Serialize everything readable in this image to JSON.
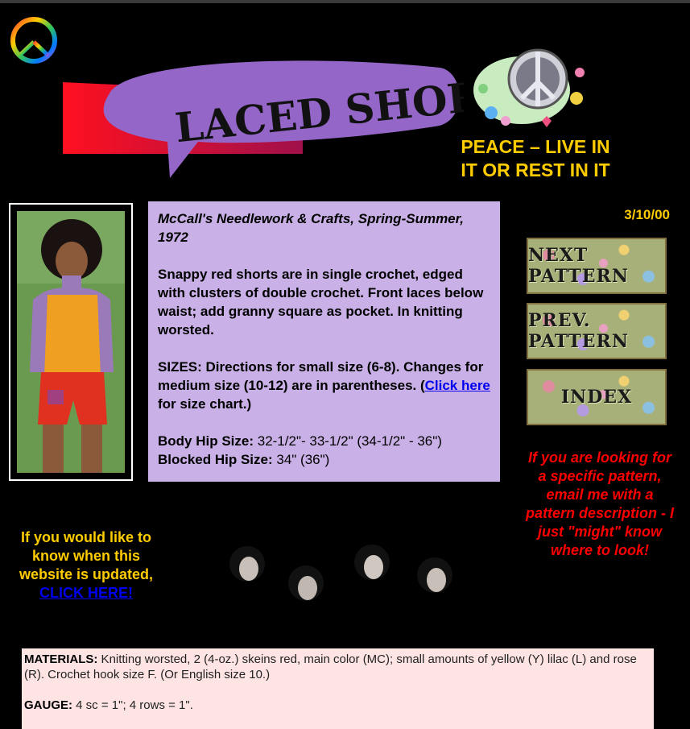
{
  "banner": {
    "title": "LACED SHORTS"
  },
  "motto": {
    "line1": "PEACE – LIVE IN",
    "line2": "IT OR REST IN IT"
  },
  "date": "3/10/00",
  "description": {
    "source": "McCall's Needlework & Crafts, Spring-Summer, 1972",
    "body": "Snappy red shorts are in single crochet, edged with clusters of double crochet. Front laces below waist; add granny square as pocket. In knitting worsted.",
    "sizes_label": "SIZES:",
    "sizes_text_1": " Directions for small size (6-8). Changes for medium size (10-12) are in parentheses. (",
    "size_chart_link": "Click here",
    "sizes_text_2": " for size chart.)",
    "body_hip_label": "Body Hip Size:",
    "body_hip_value": " 32-1/2\"- 33-1/2\" (34-1/2\" - 36\")",
    "blocked_hip_label": " Blocked Hip Size:",
    "blocked_hip_value": " 34\" (36\")"
  },
  "nav": {
    "next": "NEXT PATTERN",
    "prev": "PREV. PATTERN",
    "index": "INDEX"
  },
  "looking_text": "If you are looking for a specific pattern, email me with a pattern description - I just \"might\" know where to look!",
  "update": {
    "text": "If you would like to know when this website is updated,",
    "link": "CLICK HERE!"
  },
  "materials": {
    "label": "MATERIALS:",
    "text": " Knitting worsted, 2 (4-oz.) skeins red, main color (MC); small amounts of yellow (Y) lilac (L) and rose (R). Crochet hook size F. (Or English size 10.)"
  },
  "gauge": {
    "label": "GAUGE:",
    "text": " 4 sc = 1\"; 4 rows = 1\"."
  },
  "colors": {
    "background": "#000000",
    "motto": "#ffcc00",
    "description_bg": "#c9b0e6",
    "looking_text": "#ff0000",
    "materials_bg": "#ffe4e4",
    "link": "#0000ee"
  },
  "icons": [
    "peace-sign-icon",
    "peace-flowers-graphic",
    "beatles-faces-graphic"
  ]
}
